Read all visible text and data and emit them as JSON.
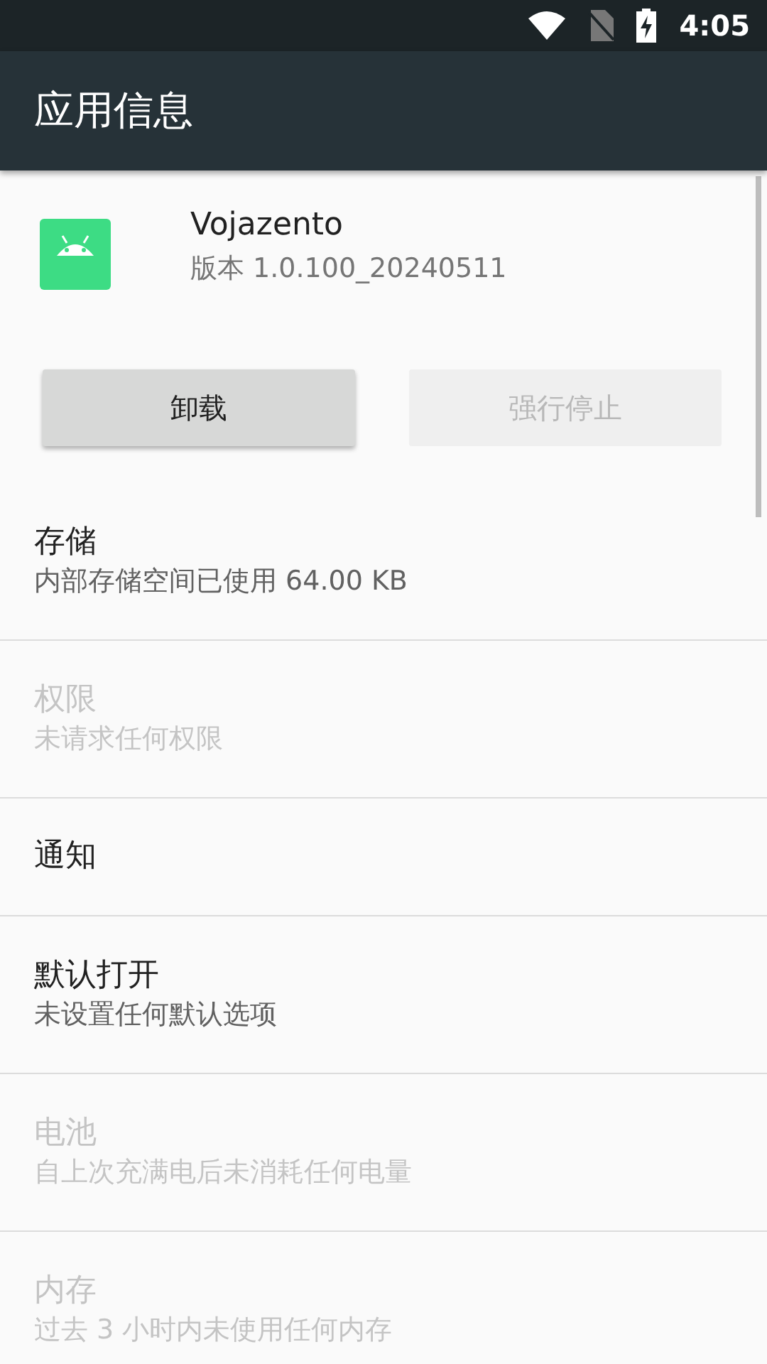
{
  "status_bar": {
    "time": "4:05"
  },
  "app_bar": {
    "title": "应用信息"
  },
  "app": {
    "name": "Vojazento",
    "version": "版本 1.0.100_20240511"
  },
  "buttons": [
    {
      "label": "卸载",
      "disabled": false
    },
    {
      "label": "强行停止",
      "disabled": true
    }
  ],
  "items": [
    {
      "title": "存储",
      "summary": "内部存储空间已使用 64.00 KB",
      "disabled": false
    },
    {
      "title": "权限",
      "summary": "未请求任何权限",
      "disabled": true
    },
    {
      "title": "通知",
      "disabled": false
    },
    {
      "title": "默认打开",
      "summary": "未设置任何默认选项",
      "disabled": false
    },
    {
      "title": "电池",
      "summary": "自上次充满电后未消耗任何电量",
      "disabled": true
    },
    {
      "title": "内存",
      "summary": "过去 3 小时内未使用任何内存",
      "disabled": true
    }
  ]
}
